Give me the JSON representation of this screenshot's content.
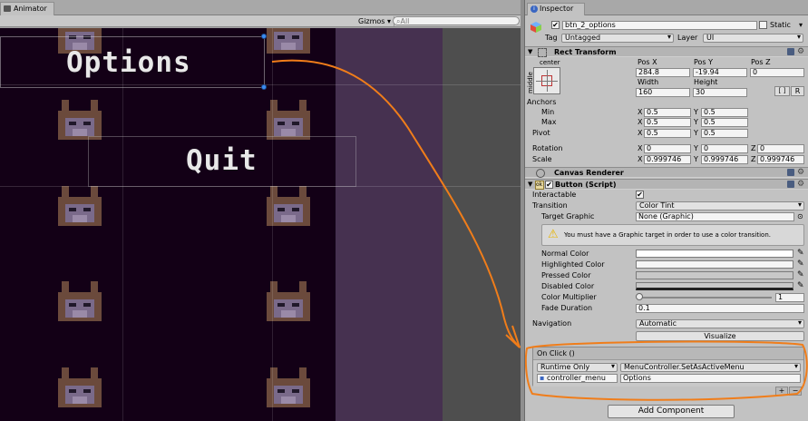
{
  "left_panel": {
    "tab_label": "Animator",
    "gizmos_label": "Gizmos",
    "search_placeholder": "All",
    "menu_options_text": "Options",
    "menu_quit_text": "Quit"
  },
  "inspector": {
    "tab_label": "Inspector",
    "object_name": "btn_2_options",
    "object_active": true,
    "static_label": "Static",
    "tag_label": "Tag",
    "tag_value": "Untagged",
    "layer_label": "Layer",
    "layer_value": "UI",
    "rect_transform": {
      "title": "Rect Transform",
      "anchor_h_label": "center",
      "anchor_v_label": "middle",
      "pos_x_label": "Pos X",
      "pos_y_label": "Pos Y",
      "pos_z_label": "Pos Z",
      "pos_x": "284.8",
      "pos_y": "-19.94",
      "pos_z": "0",
      "width_label": "Width",
      "height_label": "Height",
      "width": "160",
      "height": "30",
      "r_button": "R",
      "anchors_label": "Anchors",
      "min_label": "Min",
      "max_label": "Max",
      "min_x": "0.5",
      "min_y": "0.5",
      "max_x": "0.5",
      "max_y": "0.5",
      "pivot_label": "Pivot",
      "pivot_x": "0.5",
      "pivot_y": "0.5",
      "rotation_label": "Rotation",
      "rot_x": "0",
      "rot_y": "0",
      "rot_z": "0",
      "scale_label": "Scale",
      "scale_x": "0.999746",
      "scale_y": "0.999746",
      "scale_z": "0.999746",
      "x": "X",
      "y": "Y",
      "z": "Z"
    },
    "canvas_renderer": {
      "title": "Canvas Renderer"
    },
    "button_script": {
      "title": "Button (Script)",
      "enabled": true,
      "interactable_label": "Interactable",
      "transition_label": "Transition",
      "transition_value": "Color Tint",
      "target_graphic_label": "Target Graphic",
      "target_graphic_value": "None (Graphic)",
      "warning_text": "You must have a Graphic target in order to use a color transition.",
      "normal_color_label": "Normal Color",
      "highlighted_color_label": "Highlighted Color",
      "pressed_color_label": "Pressed Color",
      "disabled_color_label": "Disabled Color",
      "color_multiplier_label": "Color Multiplier",
      "color_multiplier_value": "1",
      "color_multiplier_fraction": 0.0,
      "fade_duration_label": "Fade Duration",
      "fade_duration_value": "0.1",
      "navigation_label": "Navigation",
      "navigation_value": "Automatic",
      "visualize_label": "Visualize",
      "on_click_label": "On Click ()",
      "runtime_value": "Runtime Only",
      "function_value": "MenuController.SetAsActiveMenu",
      "target_object": "controller_menu",
      "argument_value": "Options",
      "plus_label": "+",
      "minus_label": "−"
    },
    "add_component_label": "Add Component"
  },
  "colors": {
    "canvas_dark": "#130016",
    "canvas_purple": "#463150",
    "annotation_orange": "#f07d1a",
    "normal_color": "#ffffff",
    "highlighted_color": "#f5f5f5",
    "pressed_color": "#c8c8c8",
    "disabled_color": "#c8c8c8"
  }
}
